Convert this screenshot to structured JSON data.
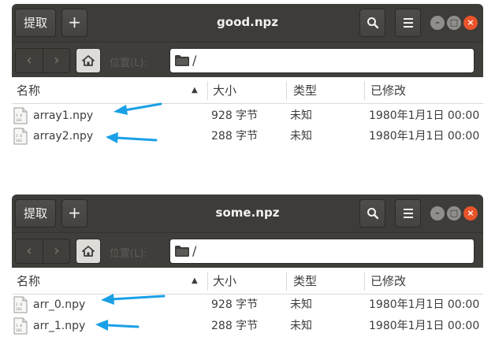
{
  "toolbar": {
    "extract_label": "提取",
    "add_label": "+"
  },
  "location_label": "位置(L):",
  "columns": {
    "name": "名称",
    "size": "大小",
    "type": "类型",
    "modified": "已修改"
  },
  "windows": [
    {
      "title": "good.npz",
      "path": "/",
      "files": [
        {
          "name": "array1.npy",
          "size": "928 字节",
          "type": "未知",
          "modified": "1980年1月1日 00:00"
        },
        {
          "name": "array2.npy",
          "size": "288 字节",
          "type": "未知",
          "modified": "1980年1月1日 00:00"
        }
      ]
    },
    {
      "title": "some.npz",
      "path": "/",
      "files": [
        {
          "name": "arr_0.npy",
          "size": "928 字节",
          "type": "未知",
          "modified": "1980年1月1日 00:00"
        },
        {
          "name": "arr_1.npy",
          "size": "288 字节",
          "type": "未知",
          "modified": "1980年1月1日 00:00"
        }
      ]
    }
  ],
  "annotation": {
    "arrow_color": "#1aa0e6"
  },
  "icons": [
    "search-icon",
    "hamburger-menu-icon",
    "home-icon",
    "folder-icon",
    "file-icon",
    "minimize-icon",
    "maximize-icon",
    "close-icon"
  ]
}
